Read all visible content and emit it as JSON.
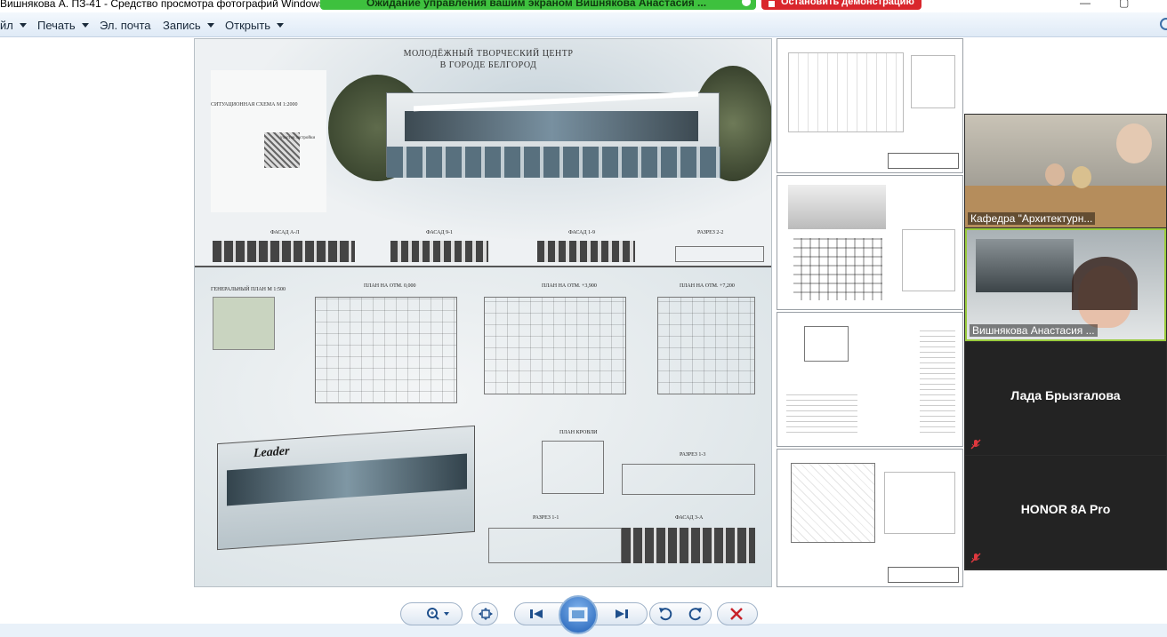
{
  "window": {
    "title": "Вишнякова А. ПЗ-41 - Средство просмотра фотографий Windows"
  },
  "share_banner": {
    "text": "Ожидание управления вашим экраном Вишнякова Анастасия ...",
    "stop_label": "Остановить демонстрацию"
  },
  "menu": {
    "items": [
      {
        "label": "йл",
        "has_dropdown": true
      },
      {
        "label": "Печать",
        "has_dropdown": true
      },
      {
        "label": "Эл. почта",
        "has_dropdown": false
      },
      {
        "label": "Запись",
        "has_dropdown": true
      },
      {
        "label": "Открыть",
        "has_dropdown": true
      }
    ]
  },
  "poster": {
    "title_line1": "МОЛОДЁЖНЫЙ ТВОРЧЕСКИЙ ЦЕНТР",
    "title_line2": "В ГОРОДЕ БЕЛГОРОД",
    "labels": {
      "situation": "СИТУАЦИОННАЯ СХЕМА М 1:2000",
      "site": "участок застройки",
      "facade_a": "ФАСАД А-Л",
      "facade_9": "ФАСАД 9-1",
      "facade_1": "ФАСАД 1-9",
      "section_22": "РАЗРЕЗ 2-2",
      "genplan": "ГЕНЕРАЛЬНЫЙ ПЛАН М 1:500",
      "plan_0": "ПЛАН НА ОТМ. 0,000",
      "plan_3": "ПЛАН НА ОТМ. +3,900",
      "plan_7": "ПЛАН НА ОТМ. +7,200",
      "roof_plan": "ПЛАН КРОВЛИ",
      "section_13": "РАЗРЕЗ 1-3",
      "section_11": "РАЗРЕЗ 1-1",
      "facade_3a": "ФАСАД 3-А",
      "brand": "Leader"
    }
  },
  "participants": [
    {
      "name": "Кафедра \"Архитектурн...",
      "video": true
    },
    {
      "name": "Вишнякова Анастасия ...",
      "video": true,
      "active": true
    },
    {
      "name": "Лада Брызгалова",
      "video": false,
      "muted": true
    },
    {
      "name": "HONOR 8A Pro",
      "video": false,
      "muted": true
    }
  ],
  "toolbar": {
    "buttons": [
      "zoom-icon",
      "fit-icon",
      "previous-icon",
      "slideshow-icon",
      "next-icon",
      "rotate-left-icon",
      "rotate-right-icon",
      "delete-icon"
    ]
  },
  "colors": {
    "share_green": "#3ec13e",
    "stop_red": "#d9262c",
    "active_speaker": "#9acb3c",
    "delete_red": "#c8222a"
  }
}
